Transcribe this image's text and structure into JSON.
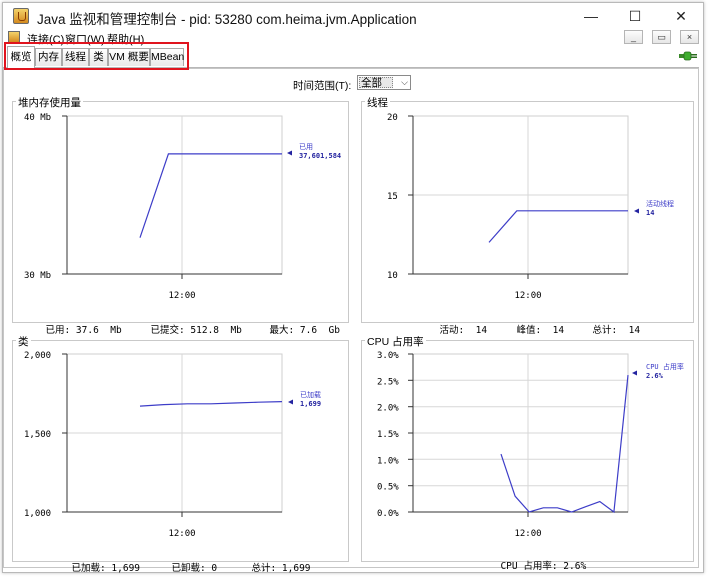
{
  "window": {
    "title": "Java 监视和管理控制台 - pid: 53280 com.heima.jvm.Application",
    "minimize": "—",
    "maximize": "☐",
    "close": "✕"
  },
  "menu": {
    "items": [
      "连接(C)",
      "窗口(W)",
      "帮助(H)"
    ],
    "mdi_buttons": [
      "_",
      "▭",
      "×"
    ]
  },
  "tabs": [
    "概览",
    "内存",
    "线程",
    "类",
    "VM 概要",
    "MBean"
  ],
  "active_tab": "概览",
  "time_range": {
    "label": "时间范围(T):",
    "value": "全部"
  },
  "charts": {
    "heap": {
      "title": "堆内存使用量",
      "y_ticks": [
        "40 Mb",
        "30 Mb"
      ],
      "x_tick": "12:00",
      "legend": {
        "label": "已用",
        "value": "37,601,584"
      },
      "footer": [
        {
          "label": "已用:",
          "value": "37.6  Mb"
        },
        {
          "label": "已提交:",
          "value": "512.8  Mb"
        },
        {
          "label": "最大:",
          "value": "7.6  Gb"
        }
      ]
    },
    "threads": {
      "title": "线程",
      "y_ticks": [
        "20",
        "15",
        "10"
      ],
      "x_tick": "12:00",
      "legend": {
        "label": "活动线程",
        "value": "14"
      },
      "footer": [
        {
          "label": "活动:",
          "value": "14"
        },
        {
          "label": "峰值:",
          "value": "14"
        },
        {
          "label": "总计:",
          "value": "14"
        }
      ]
    },
    "classes": {
      "title": "类",
      "y_ticks": [
        "2,000",
        "1,500",
        "1,000"
      ],
      "x_tick": "12:00",
      "legend": {
        "label": "已加载",
        "value": "1,699"
      },
      "footer": [
        {
          "label": "已加载:",
          "value": "1,699"
        },
        {
          "label": "已卸载:",
          "value": "0"
        },
        {
          "label": "总计:",
          "value": "1,699"
        }
      ]
    },
    "cpu": {
      "title": "CPU 占用率",
      "y_ticks": [
        "3.0%",
        "2.5%",
        "2.0%",
        "1.5%",
        "1.0%",
        "0.5%",
        "0.0%"
      ],
      "x_tick": "12:00",
      "legend": {
        "label": "CPU 占用率",
        "value": "2.6%"
      },
      "footer": [
        {
          "label": "CPU 占用率:",
          "value": "2.6%"
        }
      ]
    }
  },
  "chart_data": [
    {
      "type": "line",
      "title": "堆内存使用量",
      "y_unit": "Mb",
      "ylim": [
        30,
        40
      ],
      "x": [
        "",
        "",
        "12:00",
        "",
        "",
        ""
      ],
      "series": [
        {
          "name": "已用",
          "values": [
            32.3,
            37.6,
            37.6,
            37.6,
            37.6,
            37.6
          ]
        }
      ],
      "color": "#3d3dc8"
    },
    {
      "type": "line",
      "title": "线程",
      "ylim": [
        10,
        20
      ],
      "series": [
        {
          "name": "活动线程",
          "values": [
            12,
            14,
            14,
            14,
            14,
            14
          ]
        }
      ],
      "color": "#3d3dc8"
    },
    {
      "type": "line",
      "title": "类",
      "ylim": [
        1000,
        2000
      ],
      "series": [
        {
          "name": "已加载",
          "values": [
            1670,
            1680,
            1685,
            1685,
            1690,
            1695,
            1699
          ]
        }
      ],
      "color": "#3d3dc8"
    },
    {
      "type": "line",
      "title": "CPU 占用率",
      "y_unit": "%",
      "ylim": [
        0,
        3
      ],
      "series": [
        {
          "name": "CPU 占用率",
          "values": [
            1.1,
            0.3,
            0.0,
            0.08,
            0.08,
            0.0,
            0.1,
            0.2,
            0.0,
            2.6
          ]
        }
      ],
      "color": "#3d3dc8"
    }
  ]
}
